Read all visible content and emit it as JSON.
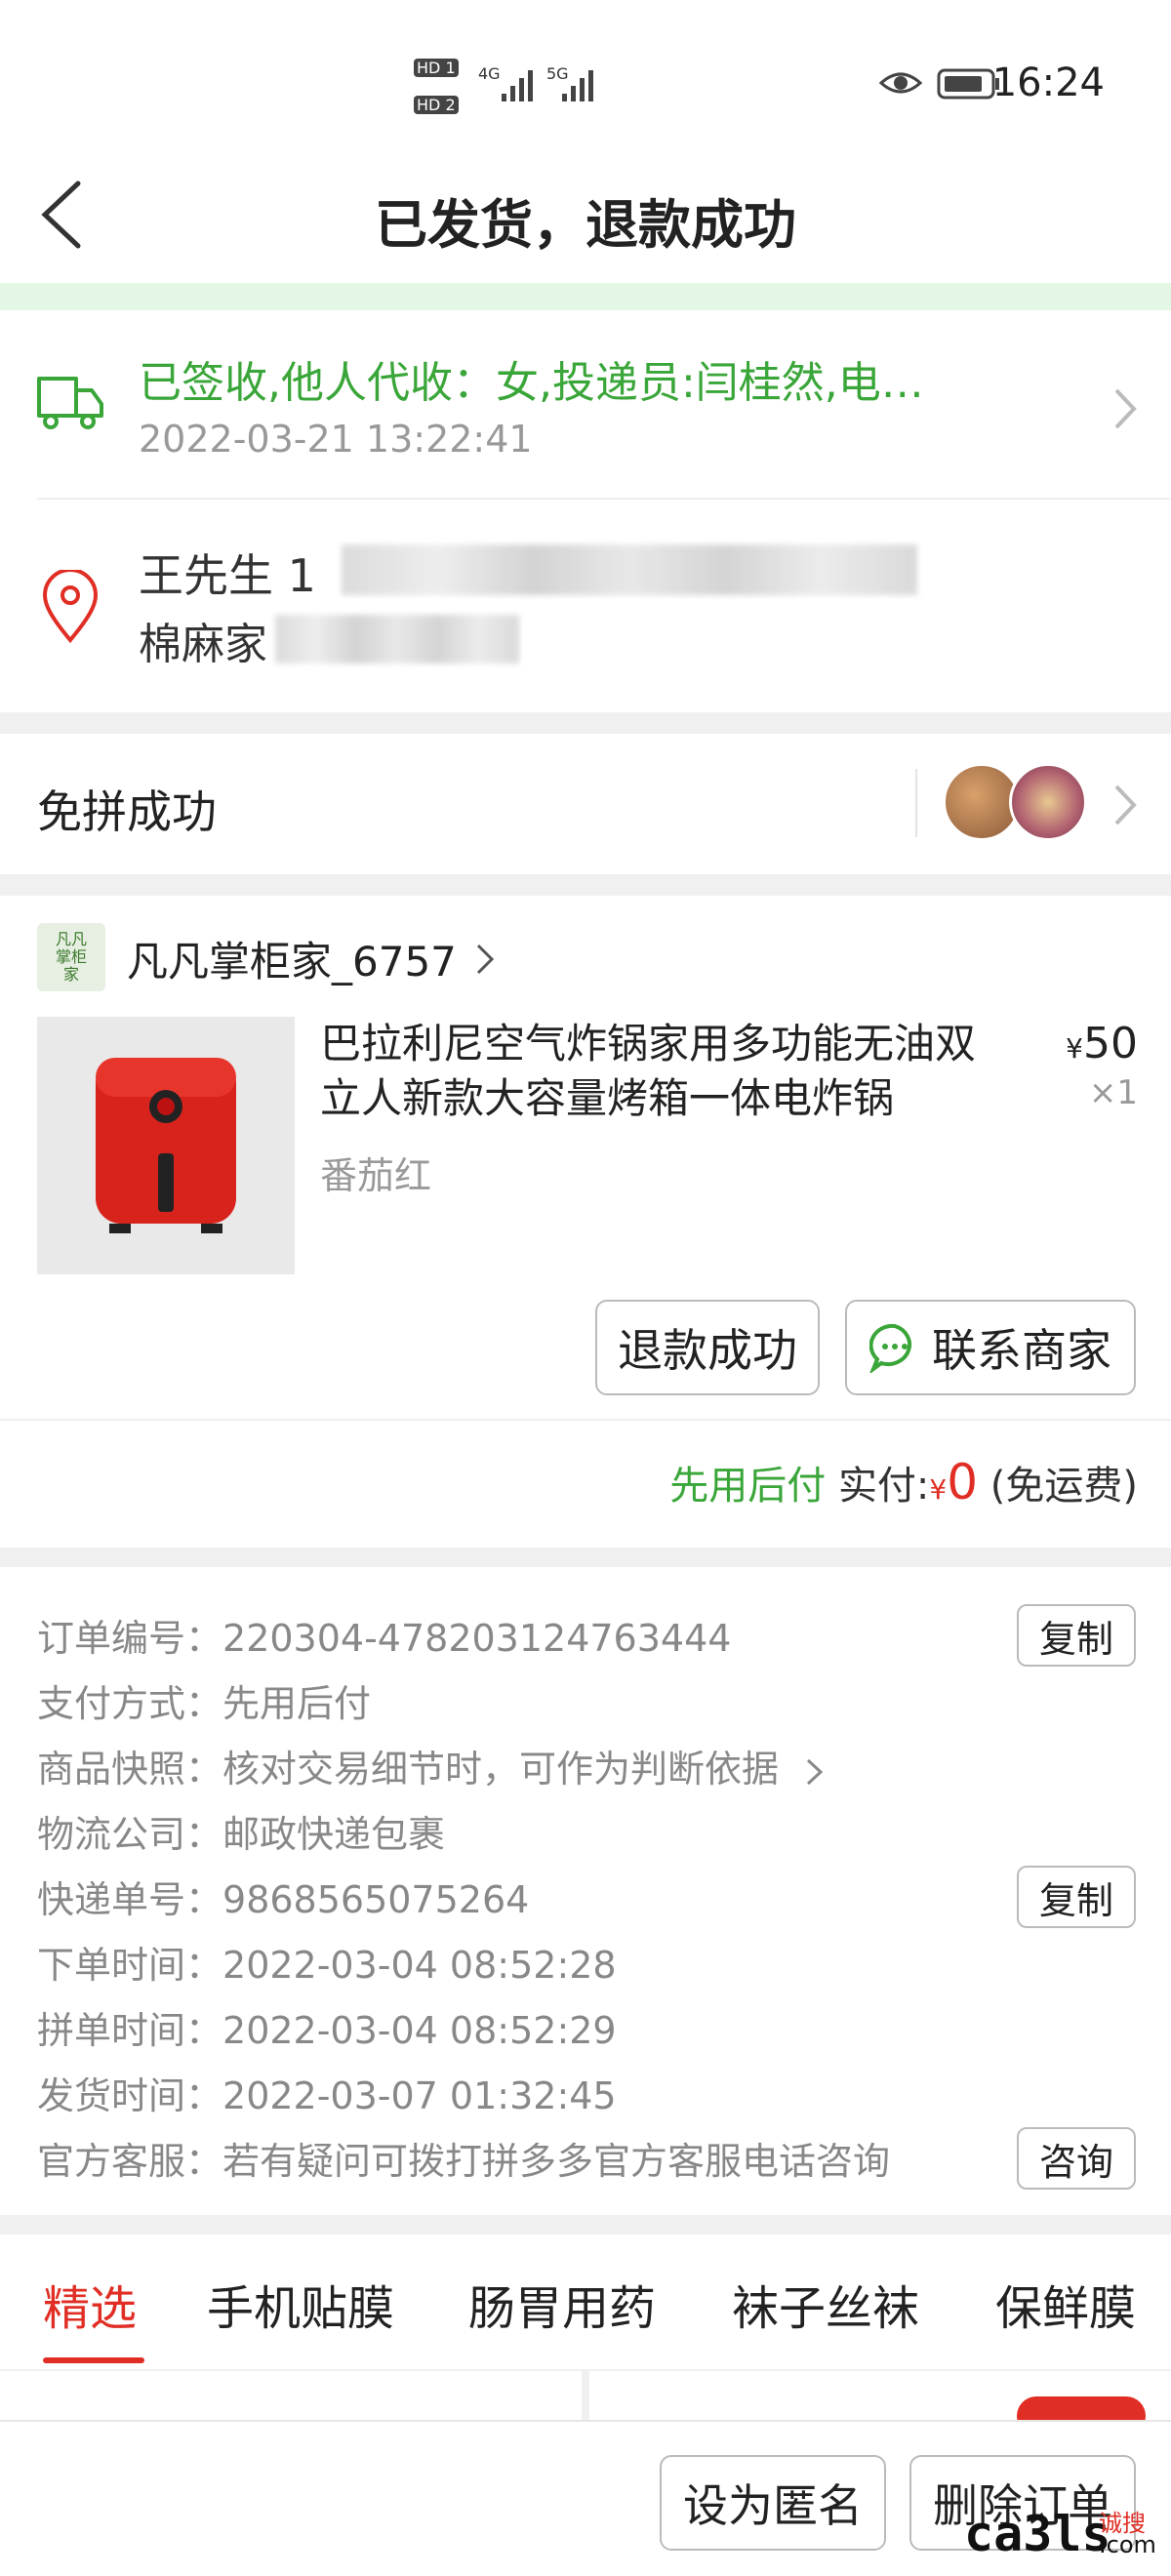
{
  "status_bar": {
    "time": "16:24",
    "hd1": "HD 1",
    "hd2": "HD 2",
    "net1": "4G",
    "net2": "5G"
  },
  "nav": {
    "title": "已发货，退款成功"
  },
  "tracking": {
    "status": "已签收,他人代收：女,投递员:闫桂然,电…",
    "time": "2022-03-21 13:22:41"
  },
  "address": {
    "name": "王先生",
    "phone_prefix": "1",
    "addr_prefix": "棉麻家"
  },
  "group": {
    "label": "免拼成功"
  },
  "order": {
    "shop_logo": "凡凡掌柜家",
    "shop_name": "凡凡掌柜家_6757",
    "product_title": "巴拉利尼空气炸锅家用多功能无油双立人新款大容量烤箱一体电炸锅",
    "variant": "番茄红",
    "currency": "¥",
    "price": "50",
    "qty": "×1",
    "refund_button": "退款成功",
    "contact_button": "联系商家",
    "pay_type_label": "先用后付",
    "paid_label": "实付:",
    "paid_currency": "¥",
    "paid_amount": "0",
    "shipping_note": "(免运费)"
  },
  "info": {
    "order_no_label": "订单编号：",
    "order_no": "220304-478203124763444",
    "copy1": "复制",
    "payment_label": "支付方式：",
    "payment": "先用后付",
    "snapshot_label": "商品快照：",
    "snapshot": "核对交易细节时，可作为判断依据",
    "logistics_label": "物流公司：",
    "logistics": "邮政快递包裹",
    "tracking_no_label": "快递单号：",
    "tracking_no": "9868565075264",
    "copy2": "复制",
    "order_time_label": "下单时间：",
    "order_time": "2022-03-04 08:52:28",
    "group_time_label": "拼单时间：",
    "group_time": "2022-03-04 08:52:29",
    "ship_time_label": "发货时间：",
    "ship_time": "2022-03-07 01:32:45",
    "service_label": "官方客服：",
    "service": "若有疑问可拨打拼多多官方客服电话咨询",
    "consult": "咨询"
  },
  "tabs": [
    "精选",
    "手机贴膜",
    "肠胃用药",
    "袜子丝袜",
    "保鲜膜"
  ],
  "bottom": {
    "anonymous": "设为匿名",
    "delete": "删除订单"
  },
  "watermark": {
    "main": "ca3ls",
    "sub1": "诚搜",
    "sub2": ".com"
  },
  "colors": {
    "green": "#3aa639",
    "red": "#e02e24",
    "accent_tab": "#e02e24"
  }
}
